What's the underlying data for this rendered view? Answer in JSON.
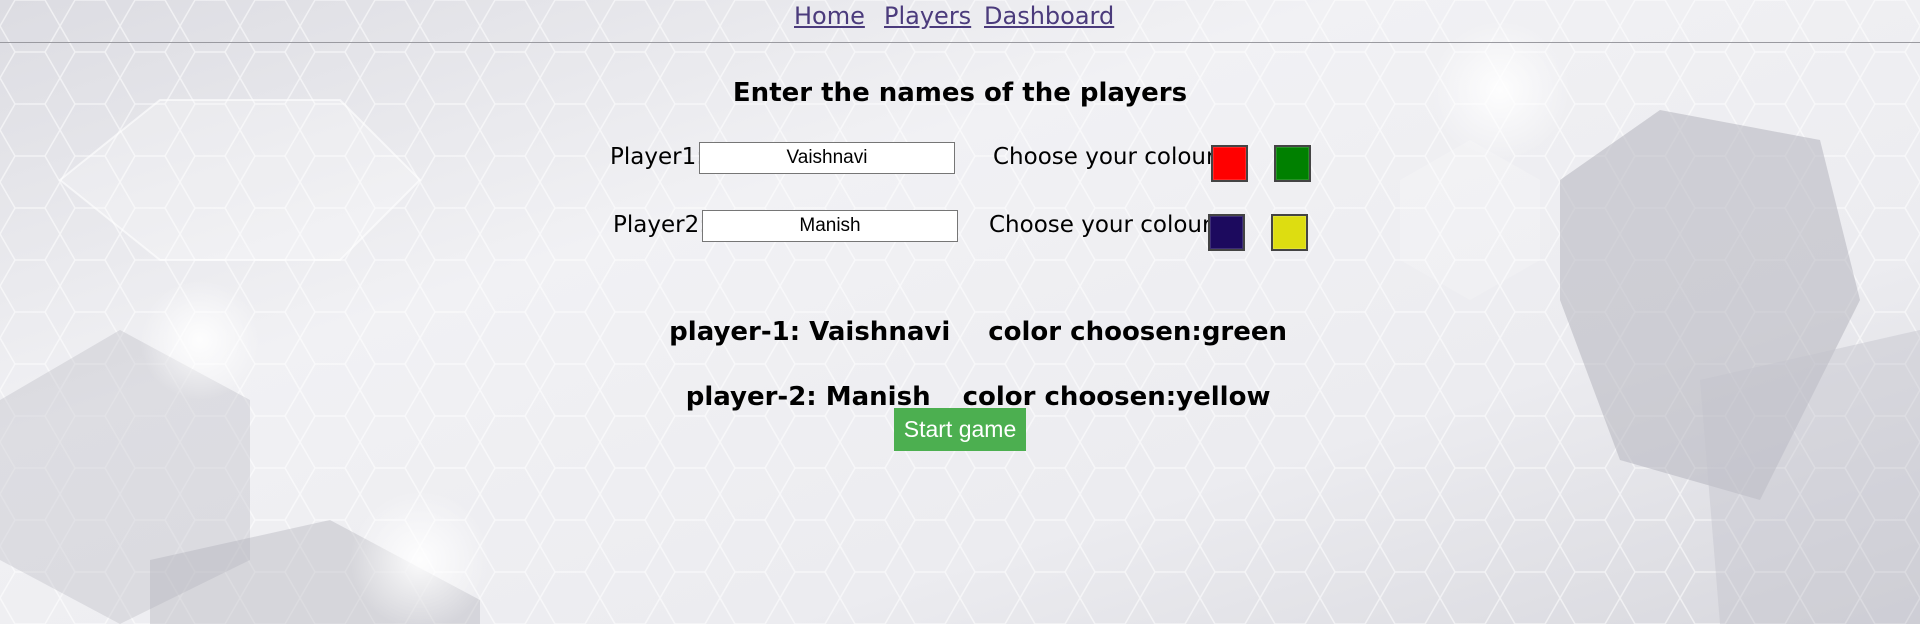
{
  "nav": {
    "links": [
      {
        "label": "Home"
      },
      {
        "label": "Players"
      },
      {
        "label": "Dashboard"
      }
    ],
    "link_color": "#4b3b7c"
  },
  "form": {
    "heading": "Enter the names of the players",
    "players": [
      {
        "label": "Player1:",
        "name_value": "Vaishnavi",
        "colour_label": "Choose your colour:",
        "colour_options": [
          {
            "name": "red",
            "hex": "#ff0000"
          },
          {
            "name": "green",
            "hex": "#008000"
          }
        ]
      },
      {
        "label": "Player2:",
        "name_value": "Manish",
        "colour_label": "Choose your colour:",
        "colour_options": [
          {
            "name": "navy",
            "hex": "#1c0a5e"
          },
          {
            "name": "yellow",
            "hex": "#dddd11"
          }
        ]
      }
    ]
  },
  "summary": {
    "player1_text": "player-1: Vaishnavi",
    "player1_color_text": "color choosen:green",
    "player2_text": "player-2: Manish",
    "player2_color_text": "color choosen:yellow"
  },
  "start_button": {
    "label": "Start game",
    "color": "#4caf50"
  }
}
